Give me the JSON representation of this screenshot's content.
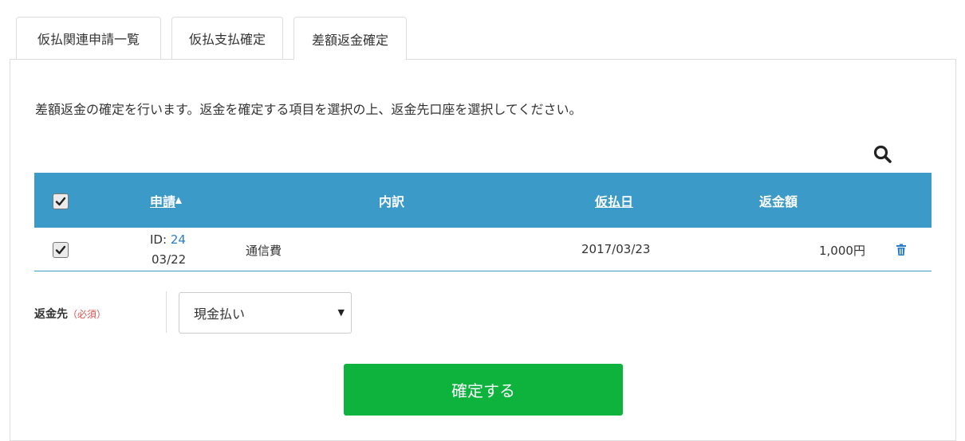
{
  "tabs": [
    {
      "label": "仮払関連申請一覧",
      "active": false
    },
    {
      "label": "仮払支払確定",
      "active": false
    },
    {
      "label": "差額返金確定",
      "active": true
    }
  ],
  "description": "差額返金の確定を行います。返金を確定する項目を選択の上、返金先口座を選択してください。",
  "icons": {
    "search": "search-icon",
    "delete": "trash-icon",
    "checkbox": "checkmark-icon"
  },
  "table": {
    "headers": {
      "application": "申請",
      "sort_indicator": "▲",
      "breakdown": "内訳",
      "advance_date": "仮払日",
      "refund_amount": "返金額"
    },
    "header_all_checked": true,
    "rows": [
      {
        "checked": true,
        "id_label": "ID:",
        "id_value": "24",
        "date": "03/22",
        "breakdown": "通信費",
        "advance_date": "2017/03/23",
        "refund_amount": "1,000円"
      }
    ]
  },
  "refund_destination": {
    "label": "返金先",
    "required_text": "（必須）",
    "selected": "現金払い",
    "arrow": "▼"
  },
  "submit_label": "確定する",
  "colors": {
    "header_bg": "#3c9ac9",
    "submit_bg": "#0db33d",
    "link": "#2a7dc9",
    "required": "#d9534f"
  }
}
